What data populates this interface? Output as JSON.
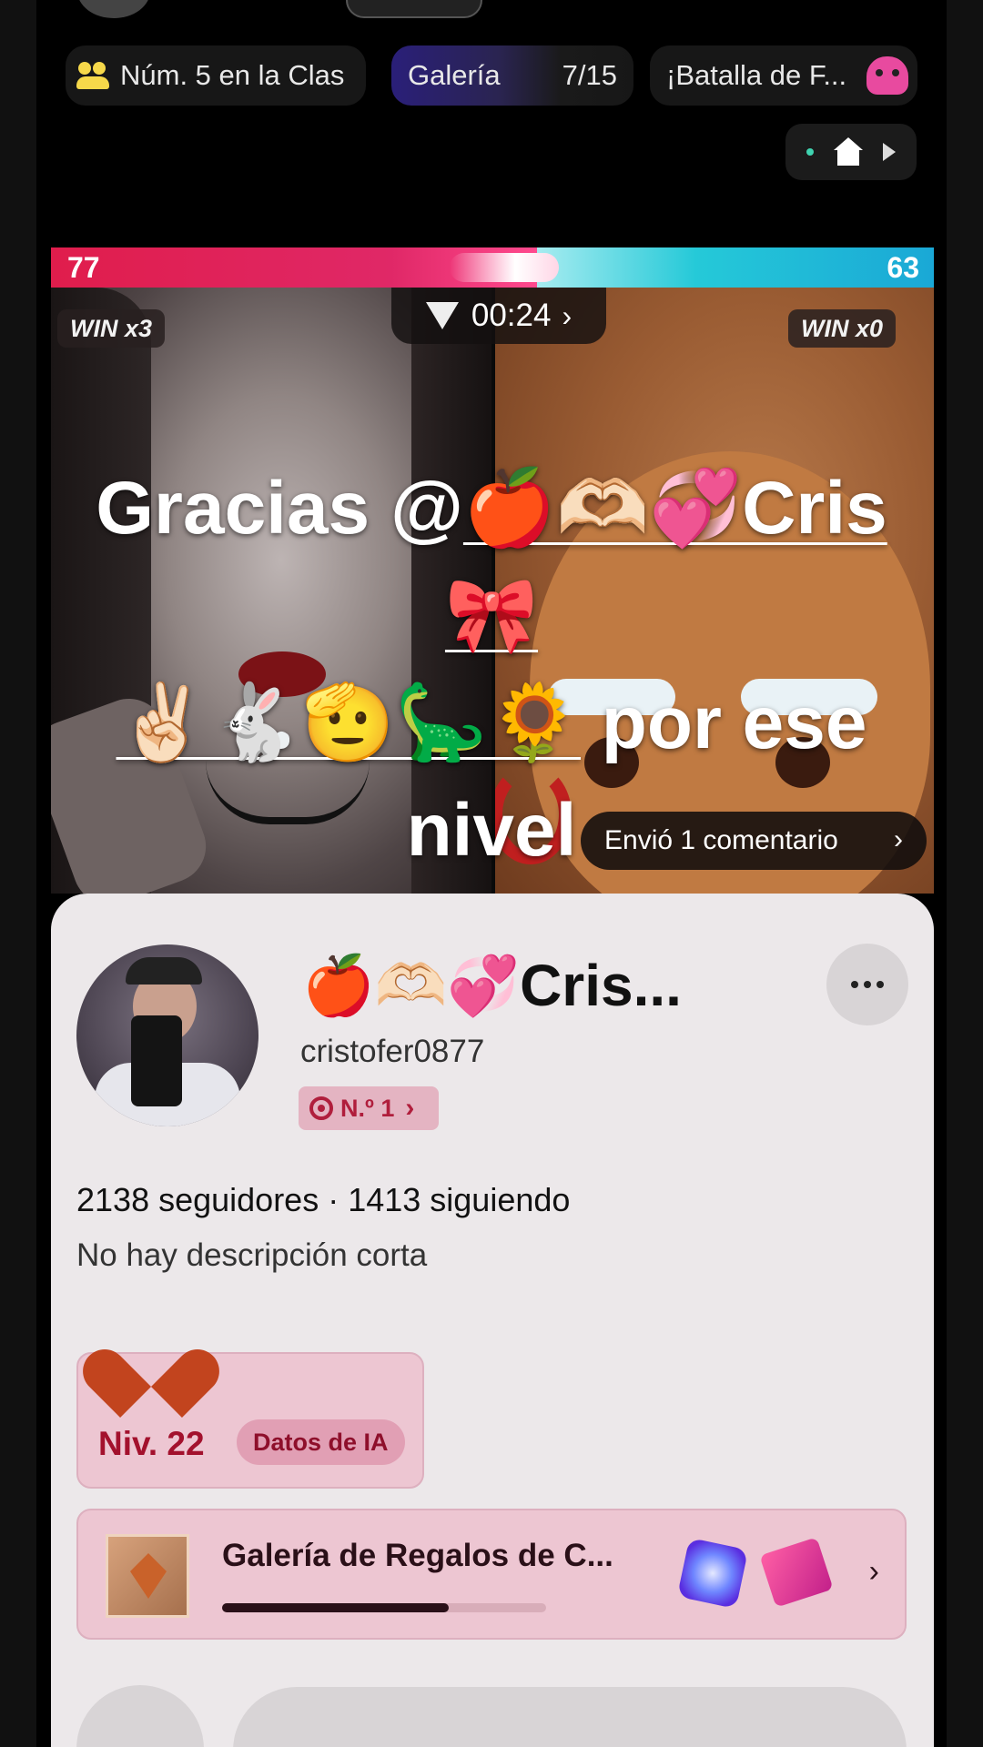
{
  "top_chips": {
    "rank_label": "Núm. 5 en la Clas",
    "gallery_label": "Galería",
    "gallery_count": "7/15",
    "battle_label": "¡Batalla de F..."
  },
  "battle": {
    "score_left": "77",
    "score_right": "63",
    "win_left": "WIN x3",
    "win_right": "WIN x0",
    "timer": "00:24",
    "colors": {
      "left": "#e01d4c",
      "right": "#25c9d8"
    },
    "left_share": 0.55
  },
  "banner": {
    "prefix": "Gracias @",
    "mention_line1": "🍎🫶🏻💞Cris🎀",
    "mention_line2": "✌🏻🐇🫡🦕🌻",
    "suffix_line2": " por ese",
    "line3": "nivel"
  },
  "comment_pill": {
    "label": "Envió 1 comentario"
  },
  "profile": {
    "display_name": "🍎🫶🏻💞Cris...",
    "username": "cristofer0877",
    "rank_badge": "N.º 1",
    "stats": "2138 seguidores · 1413 siguiendo",
    "description": "No hay descripción corta",
    "level": "Niv. 22",
    "ai_button": "Datos de IA",
    "gallery_title": "Galería de Regalos de C...",
    "gallery_progress": 0.7
  },
  "icons": {
    "people": "people-icon",
    "home": "home-icon",
    "play": "play-icon",
    "gem": "heart-gem-icon",
    "more": "more-dots-icon",
    "rank": "target-icon",
    "level_heart": "heart-icon",
    "gallery": "gift-gem-icon"
  }
}
